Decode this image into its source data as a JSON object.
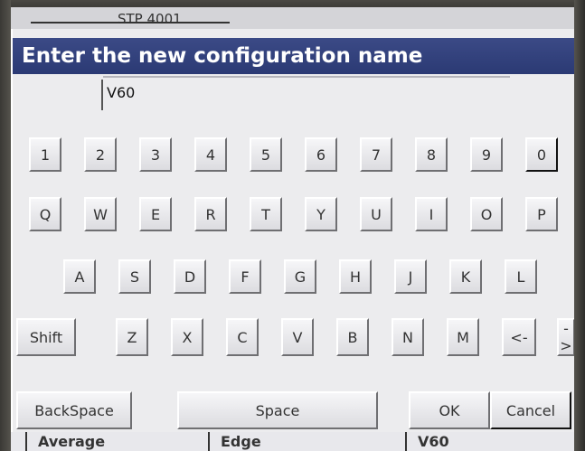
{
  "background": {
    "title_fragment": "STP 4001",
    "bottom_cells": [
      "Average",
      "Edge",
      "V60"
    ]
  },
  "dialog": {
    "title": "Enter the new configuration name",
    "name_value": "V60"
  },
  "keyboard": {
    "row_digits": [
      "1",
      "2",
      "3",
      "4",
      "5",
      "6",
      "7",
      "8",
      "9",
      "0"
    ],
    "row_q": [
      "Q",
      "W",
      "E",
      "R",
      "T",
      "Y",
      "U",
      "I",
      "O",
      "P"
    ],
    "row_a": [
      "A",
      "S",
      "D",
      "F",
      "G",
      "H",
      "J",
      "K",
      "L"
    ],
    "row_z": [
      "Shift",
      "Z",
      "X",
      "C",
      "V",
      "B",
      "N",
      "M",
      "<-",
      "->"
    ]
  },
  "actions": {
    "backspace": "BackSpace",
    "space": "Space",
    "ok": "OK",
    "cancel": "Cancel"
  },
  "colors": {
    "titlebar": "#2f3d79",
    "dialog_bg": "#ececee",
    "key_face": "#e8e8ec"
  }
}
